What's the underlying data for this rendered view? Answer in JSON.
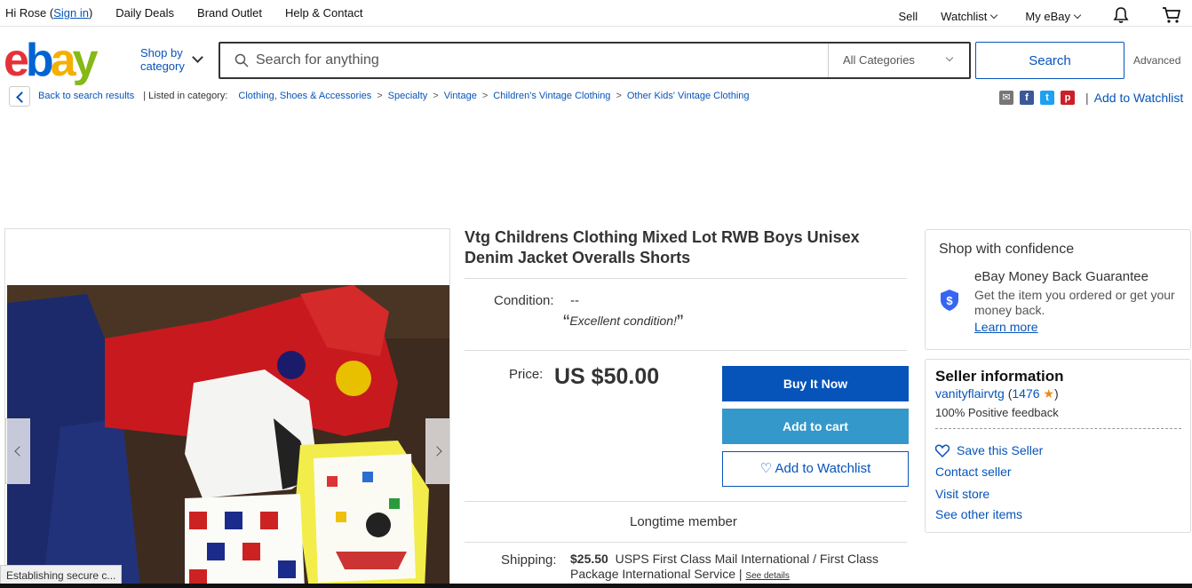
{
  "topbar": {
    "greeting": "Hi Rose (",
    "sign_in": "Sign in",
    "greeting_end": ")",
    "daily_deals": "Daily Deals",
    "brand_outlet": "Brand Outlet",
    "help": "Help & Contact",
    "sell": "Sell",
    "watchlist": "Watchlist",
    "my_ebay": "My eBay"
  },
  "header": {
    "logo": [
      "e",
      "b",
      "a",
      "y"
    ],
    "shop_by_line1": "Shop by",
    "shop_by_line2": "category",
    "search_placeholder": "Search for anything",
    "category": "All Categories",
    "search_button": "Search",
    "advanced": "Advanced"
  },
  "breadcrumb": {
    "back": "Back to search results",
    "listed_in": "| Listed in category:",
    "items": [
      "Clothing, Shoes & Accessories",
      "Specialty",
      "Vintage",
      "Children's Vintage Clothing",
      "Other Kids' Vintage Clothing"
    ],
    "separator": ">",
    "add_to_watchlist": "Add to Watchlist",
    "pipe": "|"
  },
  "share_icons": [
    "email-icon",
    "facebook-icon",
    "twitter-icon",
    "pinterest-icon"
  ],
  "listing": {
    "title": "Vtg Childrens Clothing Mixed Lot RWB Boys Unisex Denim Jacket Overalls Shorts",
    "condition_label": "Condition:",
    "condition_value": "--",
    "condition_note": "Excellent condition!",
    "quote_open": "“",
    "quote_close": "”",
    "price_label": "Price:",
    "price": "US $50.00",
    "buy_now": "Buy It Now",
    "add_to_cart": "Add to cart",
    "add_to_watchlist": "♡ Add to Watchlist",
    "longtime": "Longtime member",
    "shipping_label": "Shipping:",
    "shipping_cost": "$25.50",
    "shipping_service": "USPS First Class Mail International / First Class Package International Service |",
    "see_details": "See details"
  },
  "confidence": {
    "title": "Shop with confidence",
    "heading": "eBay Money Back Guarantee",
    "description": "Get the item you ordered or get your money back.",
    "learn_more": "Learn more"
  },
  "seller": {
    "title": "Seller information",
    "name": "vanityflairvtg",
    "score": "1476",
    "open": " (",
    "close": ")",
    "feedback": "100% Positive feedback",
    "save": "Save this Seller",
    "contact": "Contact seller",
    "visit": "Visit store",
    "other": "See other items"
  },
  "status_bar": "Establishing secure c...",
  "colors": {
    "ebay_red": "#e53238",
    "ebay_blue": "#0064d2",
    "ebay_yellow": "#f5af02",
    "ebay_green": "#86b817",
    "link_blue": "#0654ba",
    "cart_blue": "#3498ca"
  }
}
